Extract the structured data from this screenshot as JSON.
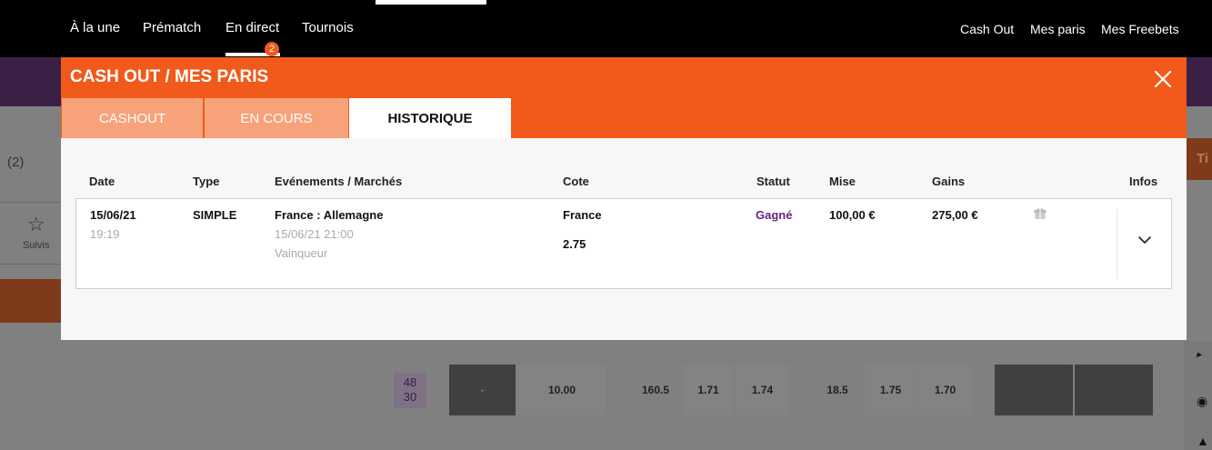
{
  "topnav": {
    "items": [
      "À la une",
      "Prématch",
      "En direct",
      "Tournois"
    ],
    "live_badge": "2",
    "right_links": [
      "Cash Out",
      "Mes paris",
      "Mes Freebets"
    ]
  },
  "background": {
    "count_label": "(2)",
    "follow_label": "Suivis",
    "right_tab_partial": "Ti",
    "score": {
      "home": "48",
      "away": "30"
    },
    "odds": [
      "-",
      "10.00",
      "160.5",
      "1.71",
      "1.74",
      "18.5",
      "1.75",
      "1.70"
    ]
  },
  "modal": {
    "title": "CASH OUT / MES PARIS",
    "tabs": [
      {
        "label": "CASHOUT",
        "active": false
      },
      {
        "label": "EN COURS",
        "active": false
      },
      {
        "label": "HISTORIQUE",
        "active": true
      }
    ],
    "columns": {
      "date": "Date",
      "type": "Type",
      "events": "Evénements / Marchés",
      "odds": "Cote",
      "status": "Statut",
      "stake": "Mise",
      "winnings": "Gains",
      "info": "Infos"
    },
    "bets": [
      {
        "date": "15/06/21",
        "time": "19:19",
        "type": "SIMPLE",
        "event": "France : Allemagne",
        "event_datetime": "15/06/21 21:00",
        "market": "Vainqueur",
        "selection": "France",
        "odds": "2.75",
        "status": "Gagné",
        "stake": "100,00 €",
        "winnings": "275,00 €"
      }
    ]
  },
  "colors": {
    "brand_orange": "#f15a1a",
    "tab_inactive": "#f8a27a",
    "status_won": "#6b1f7a",
    "header_black": "#000000"
  }
}
